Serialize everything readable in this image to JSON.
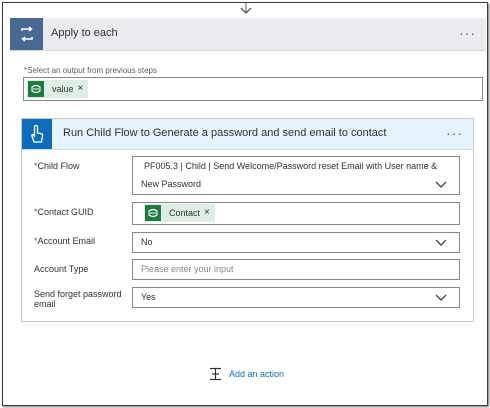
{
  "loop": {
    "title": "Apply to each",
    "select_label": "Select an output from previous steps",
    "required_mark": "*",
    "token_label": "value",
    "token_remove": "×",
    "more": "···"
  },
  "action": {
    "title": "Run Child Flow to Generate a password and send email to contact",
    "more": "···",
    "fields": {
      "child_flow": {
        "label": "Child Flow",
        "required": "*",
        "value_line1": "PF005.3 | Child | Send Welcome/Password reset Email with User name &",
        "value_line2": "New Password"
      },
      "contact_guid": {
        "label": "Contact GUID",
        "required": "*",
        "token_label": "Contact",
        "token_remove": "×"
      },
      "account_email": {
        "label": "Account Email",
        "required": "*",
        "value": "No"
      },
      "account_type": {
        "label": "Account Type",
        "placeholder": "Please enter your input"
      },
      "send_forget_password": {
        "label_line1": "Send forget password",
        "label_line2": "email",
        "value": "Yes"
      }
    }
  },
  "add_action": {
    "label": "Add an action"
  },
  "colors": {
    "loop_accent": "#486991",
    "action_accent": "#0f6cbd",
    "token_bg": "#dfeee5",
    "token_icon": "#1e7a3e",
    "link": "#0f6cbd"
  },
  "icons": {
    "loop": "loop-icon",
    "action": "touch-hand-icon",
    "token": "dataverse-icon",
    "dropdown": "chevron-down-icon",
    "add": "add-step-icon"
  }
}
